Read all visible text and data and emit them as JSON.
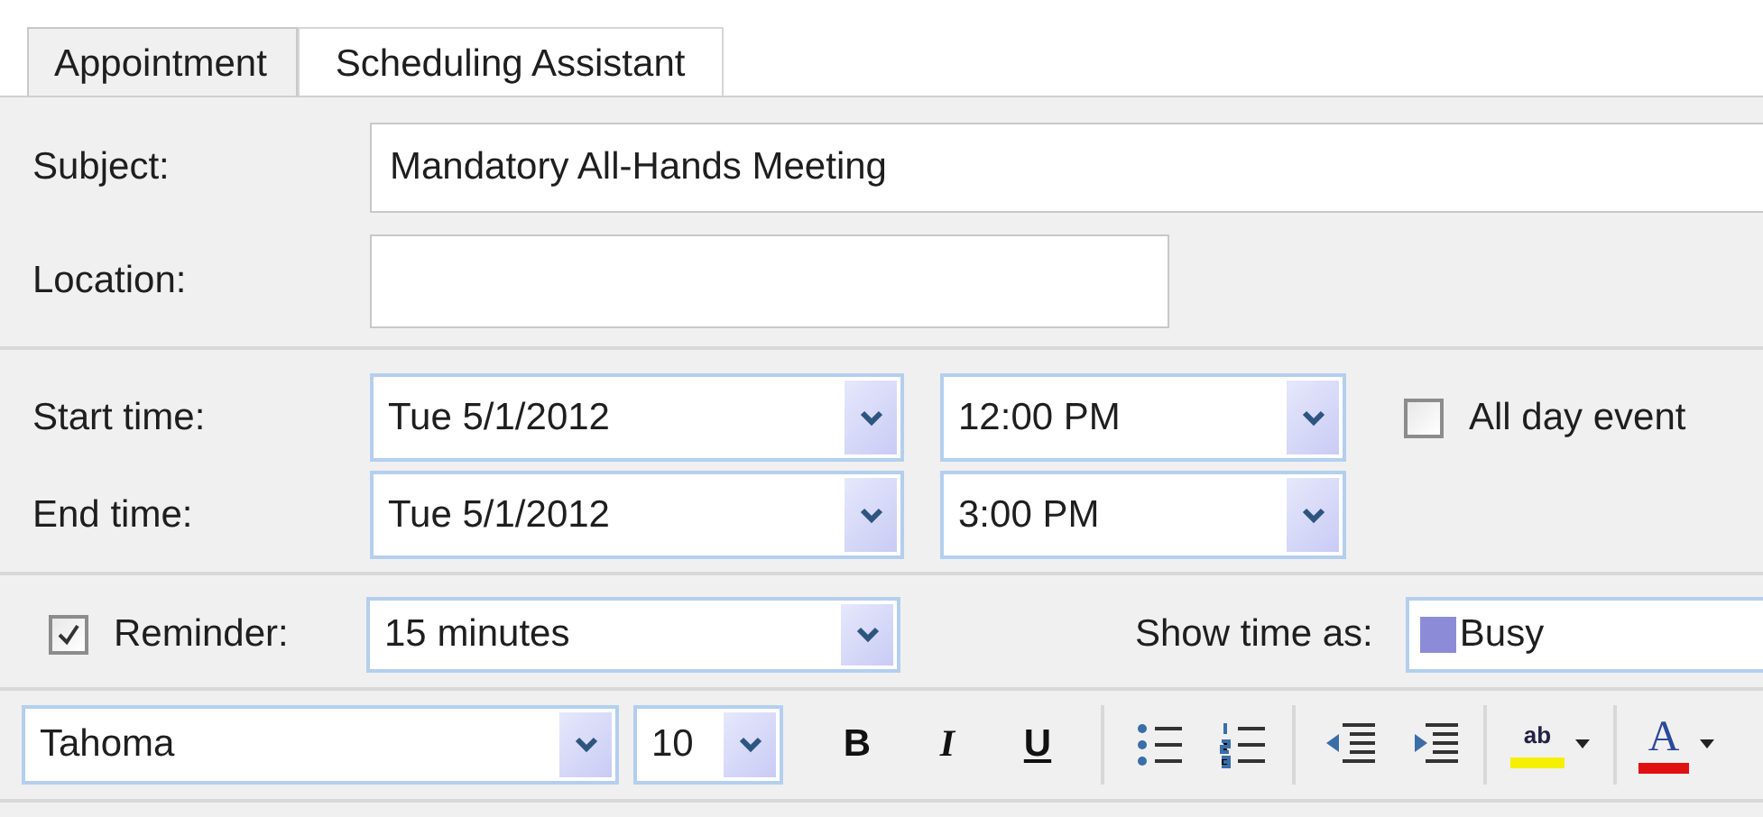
{
  "tabs": [
    {
      "label": "Appointment",
      "selected": true
    },
    {
      "label": "Scheduling Assistant",
      "selected": false
    }
  ],
  "subject": {
    "label": "Subject:",
    "value": "Mandatory All-Hands Meeting"
  },
  "location": {
    "label": "Location:"
  },
  "start": {
    "label": "Start time:",
    "date": "Tue 5/1/2012",
    "time": "12:00 PM"
  },
  "end": {
    "label": "End time:",
    "date": "Tue 5/1/2012",
    "time": "3:00 PM"
  },
  "all_day": {
    "label": "All day event",
    "checked": false
  },
  "reminder": {
    "label": "Reminder:",
    "checked": true,
    "value": "15 minutes"
  },
  "show_time_as": {
    "label": "Show time as:",
    "value": "Busy"
  },
  "toolbar": {
    "font": "Tahoma",
    "size": "10",
    "groups": [
      [
        {
          "kind": "bold",
          "label": "B"
        },
        {
          "kind": "italic",
          "label": "I"
        },
        {
          "kind": "underline",
          "label": "U"
        }
      ],
      [
        {
          "kind": "bullets"
        },
        {
          "kind": "numbering"
        }
      ],
      [
        {
          "kind": "outdent"
        },
        {
          "kind": "indent"
        }
      ],
      [
        {
          "kind": "highlight",
          "label": "ab"
        }
      ],
      [
        {
          "kind": "font-color",
          "label": "A"
        }
      ]
    ]
  }
}
